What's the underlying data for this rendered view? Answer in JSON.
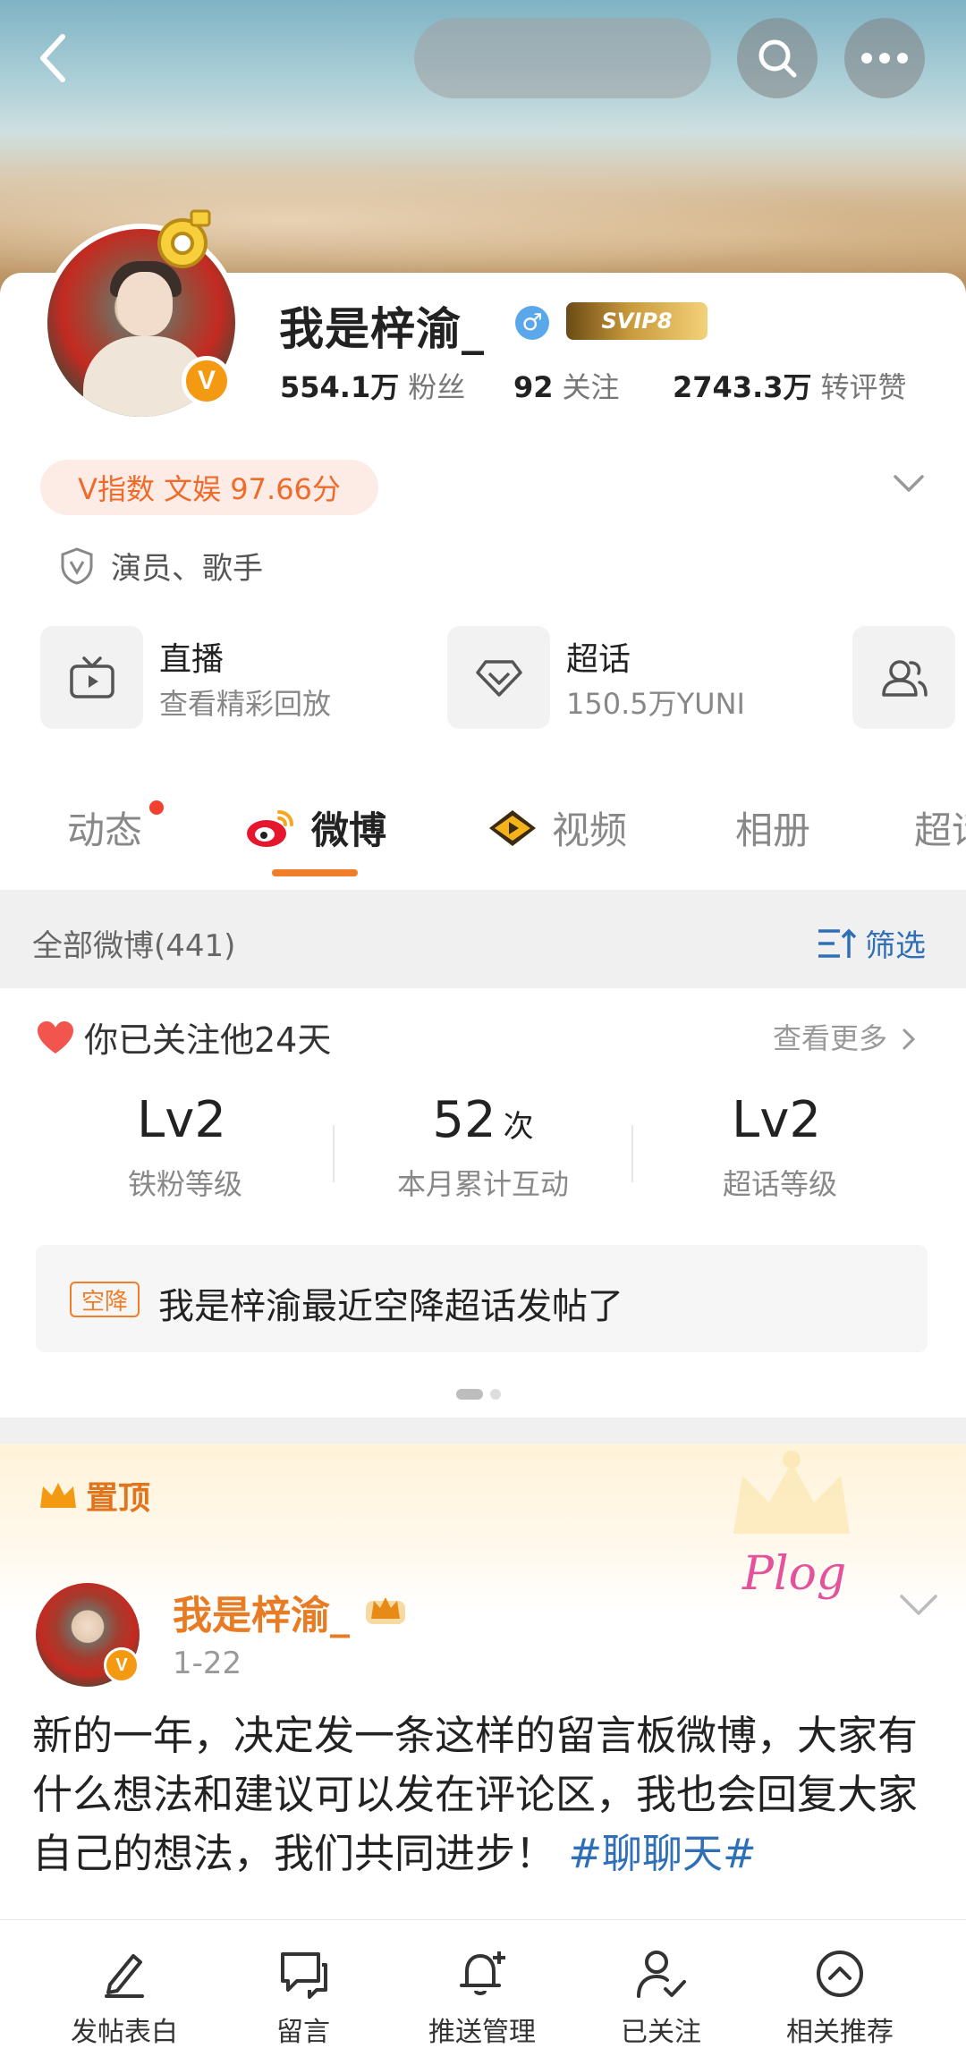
{
  "header": {
    "back_icon": "chevron-left-icon",
    "search_icon": "search-icon",
    "more_icon": "more-horizontal-icon"
  },
  "profile": {
    "name": "我是梓渝_",
    "gender_symbol": "♂",
    "svip_label": "SVIP8",
    "verified_mark": "V",
    "followers_value": "554.1万",
    "followers_label": "粉丝",
    "following_value": "92",
    "following_label": "关注",
    "likes_value": "2743.3万",
    "likes_label": "转评赞",
    "v_index": "V指数 文娱 97.66分",
    "role": "演员、歌手"
  },
  "tiles": [
    {
      "title": "直播",
      "subtitle": "查看精彩回放",
      "icon": "tv-icon"
    },
    {
      "title": "超话",
      "subtitle": "150.5万YUNI",
      "icon": "diamond-icon"
    },
    {
      "icon": "group-icon"
    }
  ],
  "tabs": [
    {
      "label": "动态"
    },
    {
      "label": "微博"
    },
    {
      "label": "视频"
    },
    {
      "label": "相册"
    },
    {
      "label": "超话"
    }
  ],
  "filter_bar": {
    "all_label": "全部微博(441)",
    "filter_label": "筛选"
  },
  "fan_card": {
    "follow_text": "你已关注他24天",
    "more_text": "查看更多",
    "metrics": [
      {
        "value": "Lv2",
        "unit": "",
        "label": "铁粉等级"
      },
      {
        "value": "52",
        "unit": "次",
        "label": "本月累计互动"
      },
      {
        "value": "Lv2",
        "unit": "",
        "label": "超话等级"
      }
    ],
    "notice_tag": "空降",
    "notice_text": "我是梓渝最近空降超话发帖了"
  },
  "pinned_post": {
    "pinned_label": "置顶",
    "author": "我是梓渝_",
    "date": "1-22",
    "plog_text": "Plog",
    "body": "新的一年，决定发一条这样的留言板微博，大家有什么想法和建议可以发在评论区，我也会回复大家自己的想法，我们共同进步！",
    "hashtag": "#聊聊天#"
  },
  "bottom_bar": [
    {
      "label": "发帖表白",
      "icon": "pen-icon"
    },
    {
      "label": "留言",
      "icon": "comment-icon"
    },
    {
      "label": "推送管理",
      "icon": "bell-plus-icon"
    },
    {
      "label": "已关注",
      "icon": "user-check-icon"
    },
    {
      "label": "相关推荐",
      "icon": "chevron-up-circle-icon"
    }
  ],
  "colors": {
    "accent_orange": "#f07d2a",
    "link_blue": "#2e6fb7",
    "verified_orange": "#f39a12"
  }
}
